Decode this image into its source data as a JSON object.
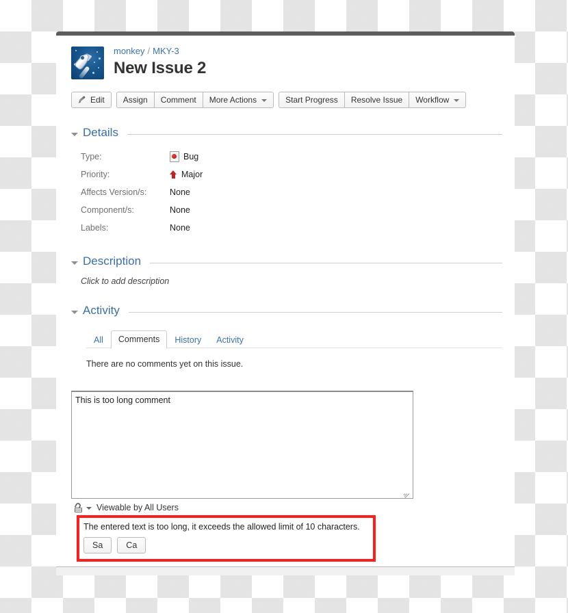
{
  "window": {
    "title_bar": ""
  },
  "header": {
    "avatar_icon": "rocket-avatar",
    "breadcrumb": {
      "project": "monkey",
      "separator": "/",
      "issue_key": "MKY-3"
    },
    "title": "New Issue 2"
  },
  "toolbar": {
    "edit_label": "Edit",
    "edit_icon": "pencil-icon",
    "assign_label": "Assign",
    "comment_label": "Comment",
    "more_actions_label": "More Actions",
    "start_progress_label": "Start Progress",
    "resolve_issue_label": "Resolve Issue",
    "workflow_label": "Workflow"
  },
  "details": {
    "section_title": "Details",
    "fields": [
      {
        "label": "Type:",
        "value": "Bug",
        "icon": "bug-icon"
      },
      {
        "label": "Priority:",
        "value": "Major",
        "icon": "major-priority-icon"
      },
      {
        "label": "Affects Version/s:",
        "value": "None",
        "icon": ""
      },
      {
        "label": "Component/s:",
        "value": "None",
        "icon": ""
      },
      {
        "label": "Labels:",
        "value": "None",
        "icon": ""
      }
    ]
  },
  "description": {
    "section_title": "Description",
    "placeholder": "Click to add description"
  },
  "activity": {
    "section_title": "Activity",
    "tabs": [
      {
        "label": "All",
        "active": false
      },
      {
        "label": "Comments",
        "active": true
      },
      {
        "label": "History",
        "active": false
      },
      {
        "label": "Activity",
        "active": false
      }
    ],
    "empty_message": "There are no comments yet on this issue."
  },
  "comment_form": {
    "textarea_value": "This is too long comment",
    "textarea_placeholder": "",
    "visibility_label": "Viewable by All Users",
    "visibility_icon": "unlocked-padlock-icon",
    "error_message": "The entered text is too long, it exceeds the allowed limit of 10 characters.",
    "save_label": "Sa",
    "cancel_label": "Ca"
  },
  "colors": {
    "link_blue": "#3b73af",
    "section_heading_blue": "#3b6fa8",
    "error_red": "#ff1d1d",
    "priority_red": "#c2251f",
    "title_bar_gray": "#5d5d5d"
  }
}
